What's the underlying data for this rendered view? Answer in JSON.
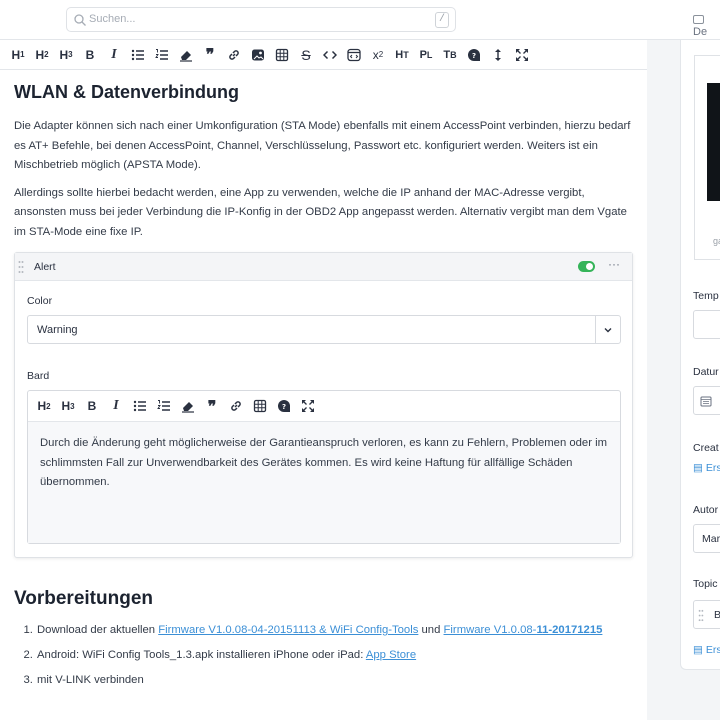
{
  "search": {
    "placeholder": "Suchen...",
    "shortcut": "/"
  },
  "right_panel": {
    "tab_label": "De"
  },
  "toolbar": {
    "buttons": [
      "H1",
      "H2",
      "H3",
      "B",
      "I",
      "bulleted-list",
      "numbered-list",
      "eraser",
      "quote",
      "link",
      "image",
      "table",
      "strikethrough",
      "code",
      "embed",
      "superscript",
      "Ht",
      "PL",
      "TB",
      "faq",
      "expand-vertical",
      "fullscreen"
    ]
  },
  "doc": {
    "heading": "WLAN & Datenverbindung",
    "p1": "Die Adapter können sich nach einer Umkonfiguration (STA Mode) ebenfalls mit einem AccessPoint verbinden, hierzu bedarf es AT+ Befehle, bei denen AccessPoint, Channel, Verschlüsselung, Passwort etc. konfiguriert werden. Weiters ist ein Mischbetrieb möglich (APSTA Mode).",
    "p2": "Allerdings sollte hierbei bedacht werden, eine App zu verwenden, welche die IP anhand der MAC-Adresse vergibt, ansonsten muss bei jeder Verbindung die IP-Konfig in der OBD2 App angepasst werden. Alternativ vergibt man dem Vgate im STA-Mode eine fixe IP.",
    "alert": {
      "title": "Alert",
      "enabled": true,
      "more": "···",
      "color_label": "Color",
      "color_value": "Warning",
      "bard_label": "Bard",
      "bard_text": "Durch die Änderung geht möglicherweise der Garantieanspruch verloren, es kann zu Fehlern, Problemen oder im schlimmsten Fall zur Unverwendbarkeit des Gerätes kommen. Es wird keine Haftung für allfällige Schäden übernommen."
    },
    "heading2": "Vorbereitungen",
    "list": {
      "item1_pre": "Download der aktuellen ",
      "item1_link1": "Firmware V1.0.08-04-20151113 & WiFi Config-Tools",
      "item1_mid": " und ",
      "item1_link2_a": "Firmware V1.0.08-",
      "item1_link2_b": "11-20171215",
      "item2_pre": "Android: WiFi Config Tools_1.3.apk installieren iPhone oder iPad: ",
      "item2_link": "App Store",
      "item3": "mit V-LINK verbinden"
    }
  },
  "sidebar": {
    "image_caption": "ga",
    "template_label": "Temp",
    "date_label": "Datur",
    "created_label": "Creat",
    "created_link": "Ers",
    "author_label": "Autor",
    "author_value": "Mar",
    "topics_label": "Topic",
    "topics_value": "Bl",
    "topics_link": "Ers"
  },
  "colors": {
    "accent": "#3b8fd6",
    "toggle_on": "#35b459",
    "heading": "#1c2330"
  }
}
